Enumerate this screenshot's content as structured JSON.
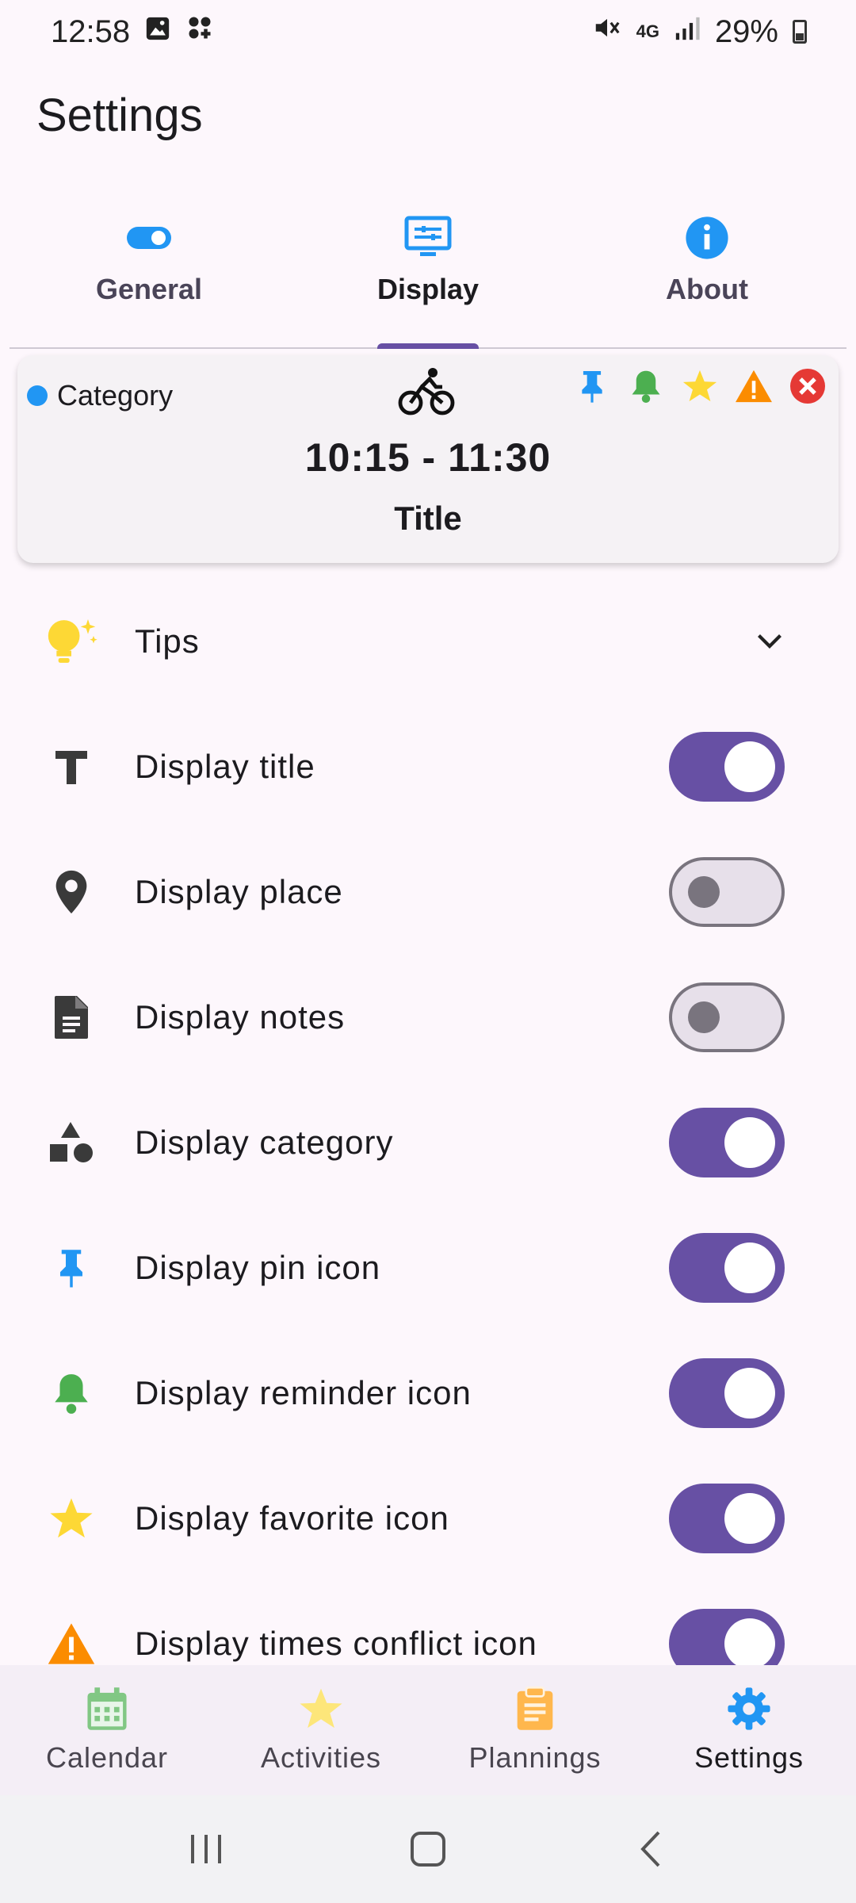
{
  "status_bar": {
    "time": "12:58",
    "network": "4G",
    "battery": "29%"
  },
  "page": {
    "title": "Settings"
  },
  "tabs": [
    {
      "label": "General",
      "icon": "toggle-icon",
      "active": false
    },
    {
      "label": "Display",
      "icon": "display-settings-icon",
      "active": true
    },
    {
      "label": "About",
      "icon": "info-icon",
      "active": false
    }
  ],
  "preview": {
    "category": "Category",
    "time_range": "10:15 - 11:30",
    "title": "Title",
    "icons": [
      "pin-icon",
      "bell-icon",
      "star-icon",
      "warning-icon",
      "close-icon"
    ],
    "colors": {
      "category_dot": "#2196f3",
      "pin": "#2196f3",
      "bell": "#4caf50",
      "star": "#fdd835",
      "warning": "#fb8c00",
      "close": "#e53935"
    }
  },
  "settings": {
    "tips_label": "Tips",
    "items": [
      {
        "label": "Display title",
        "icon": "text-icon",
        "enabled": true
      },
      {
        "label": "Display place",
        "icon": "location-pin-icon",
        "enabled": false
      },
      {
        "label": "Display notes",
        "icon": "notes-icon",
        "enabled": false
      },
      {
        "label": "Display category",
        "icon": "shapes-icon",
        "enabled": true
      },
      {
        "label": "Display pin icon",
        "icon": "pin-icon",
        "enabled": true
      },
      {
        "label": "Display reminder icon",
        "icon": "bell-icon",
        "enabled": true
      },
      {
        "label": "Display favorite icon",
        "icon": "star-icon",
        "enabled": true
      },
      {
        "label": "Display times conflict icon",
        "icon": "warning-icon",
        "enabled": true
      }
    ]
  },
  "bottom_nav": [
    {
      "label": "Calendar",
      "icon": "calendar-icon",
      "active": false
    },
    {
      "label": "Activities",
      "icon": "star-icon",
      "active": false
    },
    {
      "label": "Plannings",
      "icon": "clipboard-icon",
      "active": false
    },
    {
      "label": "Settings",
      "icon": "gear-icon",
      "active": true
    }
  ],
  "theme": {
    "accent": "#6750a4",
    "background": "#fdf7fc",
    "blue": "#2196f3"
  }
}
